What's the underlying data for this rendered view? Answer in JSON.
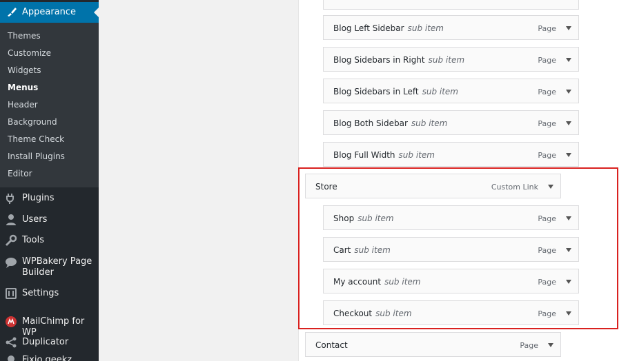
{
  "sidebar": {
    "appearance_label": "Appearance",
    "submenu": [
      "Themes",
      "Customize",
      "Widgets",
      "Menus",
      "Header",
      "Background",
      "Theme Check",
      "Install Plugins",
      "Editor"
    ],
    "current": "Menus",
    "nav": [
      {
        "label": "Plugins",
        "icon": "plug-icon"
      },
      {
        "label": "Users",
        "icon": "user-icon"
      },
      {
        "label": "Tools",
        "icon": "wrench-icon"
      },
      {
        "label": "WPBakery Page Builder",
        "icon": "chat-bubble-icon"
      },
      {
        "label": "Settings",
        "icon": "settings-icon"
      },
      {
        "label": "MailChimp for WP",
        "icon": "mailchimp-icon"
      },
      {
        "label": "Duplicator",
        "icon": "share-icon"
      },
      {
        "label": "Fixio geekz",
        "icon": "bulb-icon"
      }
    ]
  },
  "menu_items": [
    {
      "title": "Blog Left Sidebar",
      "sub": "sub item",
      "type": "Page"
    },
    {
      "title": "Blog Sidebars in Right",
      "sub": "sub item",
      "type": "Page"
    },
    {
      "title": "Blog Sidebars in Left",
      "sub": "sub item",
      "type": "Page"
    },
    {
      "title": "Blog Both Sidebar",
      "sub": "sub item",
      "type": "Page"
    },
    {
      "title": "Blog Full Width",
      "sub": "sub item",
      "type": "Page"
    },
    {
      "title": "Store",
      "sub": "",
      "type": "Custom Link"
    },
    {
      "title": "Shop",
      "sub": "sub item",
      "type": "Page"
    },
    {
      "title": "Cart",
      "sub": "sub item",
      "type": "Page"
    },
    {
      "title": "My account",
      "sub": "sub item",
      "type": "Page"
    },
    {
      "title": "Checkout",
      "sub": "sub item",
      "type": "Page"
    },
    {
      "title": "Contact",
      "sub": "",
      "type": "Page"
    }
  ],
  "colors": {
    "admin_bar": "#23282d",
    "active": "#0073aa",
    "highlight": "#d9211f"
  }
}
